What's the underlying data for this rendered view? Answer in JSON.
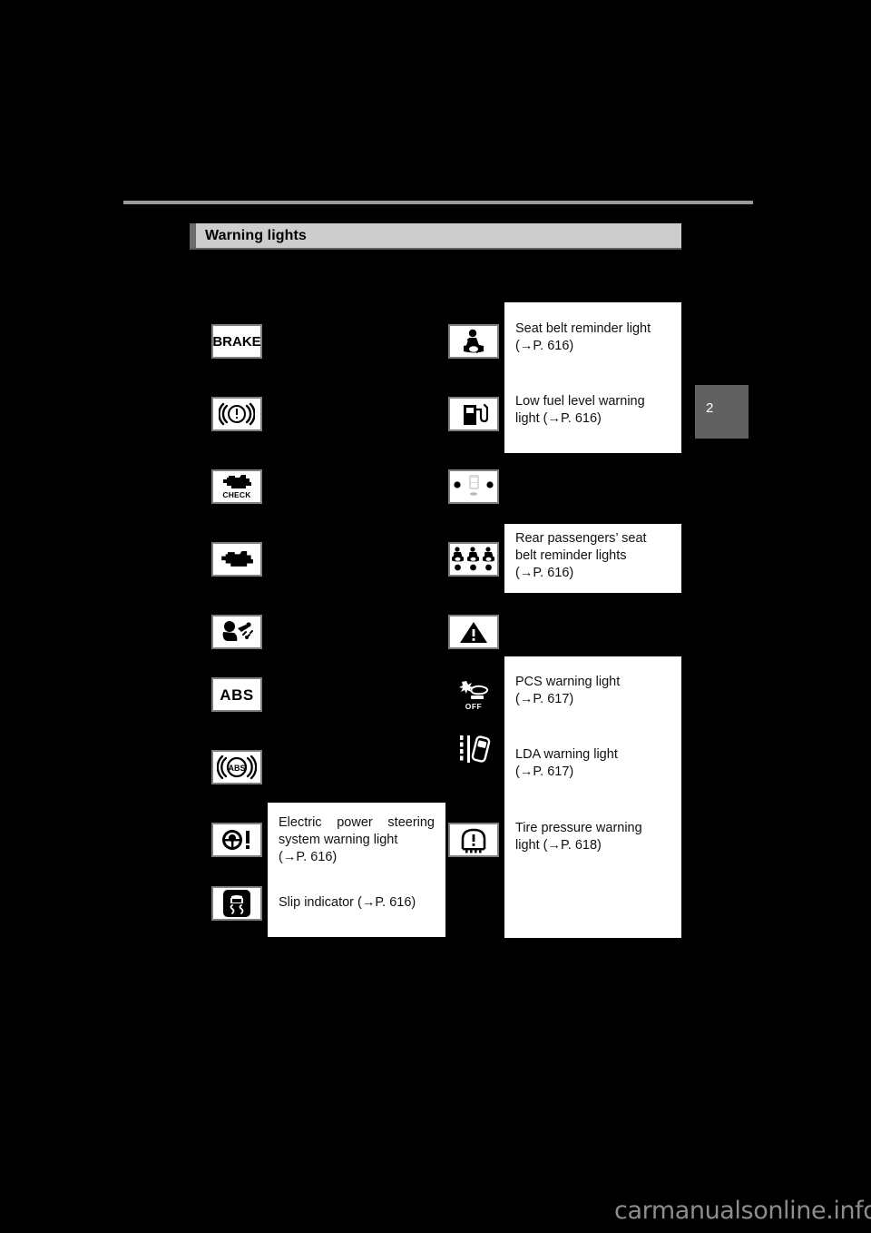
{
  "page": {
    "background_color": "#000000",
    "chapter_number": "2",
    "watermark": "carmanualsonline.info"
  },
  "section_header": {
    "title": "Warning lights",
    "background_color": "#cdcdcd",
    "accent_color": "#6b6b6b"
  },
  "left_column": {
    "icons": [
      {
        "name": "brake-warning-light-icon",
        "label": "BRAKE",
        "type": "text"
      },
      {
        "name": "brake-system-warning-light-icon",
        "label": "",
        "type": "brake-circle"
      },
      {
        "name": "check-engine-warning-light-icon",
        "label": "CHECK",
        "type": "engine-check"
      },
      {
        "name": "malfunction-indicator-lamp-icon",
        "label": "",
        "type": "engine"
      },
      {
        "name": "srs-airbag-warning-light-icon",
        "label": "",
        "type": "airbag"
      },
      {
        "name": "abs-warning-light-icon",
        "label": "ABS",
        "type": "text"
      },
      {
        "name": "brake-assist-warning-light-icon",
        "label": "ABS",
        "type": "abs-circle"
      },
      {
        "name": "electric-power-steering-warning-light-icon",
        "label": "",
        "type": "steering"
      },
      {
        "name": "slip-indicator-icon",
        "label": "",
        "type": "slip"
      }
    ],
    "callout": {
      "entries": [
        {
          "lines": [
            "Electric  power  steering",
            "system warning light",
            "(→P. 616)"
          ],
          "justified_first_line": true
        },
        {
          "lines": [
            "Slip indicator (→P. 616)"
          ],
          "justified_first_line": false
        }
      ]
    }
  },
  "right_column": {
    "icons": [
      {
        "name": "seat-belt-reminder-light-icon",
        "label": "",
        "type": "seatbelt"
      },
      {
        "name": "low-fuel-level-warning-light-icon",
        "label": "",
        "type": "fuel"
      },
      {
        "name": "front-passenger-occupant-indicator-icon",
        "label": "",
        "type": "occupant"
      },
      {
        "name": "rear-passengers-seat-belt-reminder-lights-icon",
        "label": "",
        "type": "rear-seatbelt"
      },
      {
        "name": "master-warning-light-icon",
        "label": "",
        "type": "triangle"
      },
      {
        "name": "pcs-warning-light-icon",
        "label": "OFF",
        "type": "pcs-off"
      },
      {
        "name": "lda-warning-light-icon",
        "label": "",
        "type": "lda"
      },
      {
        "name": "tire-pressure-warning-light-icon",
        "label": "",
        "type": "tire"
      }
    ],
    "callout_top": {
      "entries": [
        {
          "lines": [
            "Seat belt reminder light",
            "(→P. 616)"
          ]
        },
        {
          "lines": [
            "Low fuel level warning",
            "light (→P. 616)"
          ]
        }
      ]
    },
    "callout_mid": {
      "entries": [
        {
          "lines": [
            "Rear passengers’ seat",
            "belt reminder lights",
            "(→P. 616)"
          ]
        }
      ]
    },
    "callout_bottom": {
      "entries": [
        {
          "lines": [
            "PCS warning light",
            "(→P. 617)"
          ]
        },
        {
          "lines": [
            "LDA warning light",
            "(→P. 617)"
          ]
        },
        {
          "lines": [
            "Tire pressure warning",
            "light (→P. 618)"
          ]
        }
      ]
    }
  }
}
